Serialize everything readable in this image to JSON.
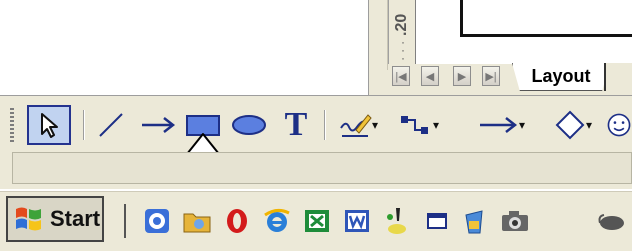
{
  "ruler": {
    "label": ".20",
    "dots": "· · ·"
  },
  "sheet_tabs": {
    "nav_first": "|◀",
    "nav_prev": "◀",
    "nav_next": "▶",
    "nav_last": "▶|",
    "active_tab": "Layout"
  },
  "drawing_toolbar": {
    "tools": [
      {
        "name": "select-tool",
        "icon": "pointer-arrow",
        "active": true
      },
      {
        "name": "line-tool",
        "icon": "line"
      },
      {
        "name": "arrow-tool",
        "icon": "arrow"
      },
      {
        "name": "rectangle-tool",
        "icon": "rectangle"
      },
      {
        "name": "ellipse-tool",
        "icon": "ellipse"
      },
      {
        "name": "text-tool",
        "icon": "T",
        "glyph": "T"
      },
      {
        "name": "freeform-line-tool",
        "icon": "freeform-line"
      },
      {
        "name": "connector-tool",
        "icon": "connector"
      },
      {
        "name": "arrows-tool",
        "icon": "arrows"
      },
      {
        "name": "flowchart-tool",
        "icon": "diamond"
      },
      {
        "name": "symbol-shapes-tool",
        "icon": "smiley"
      }
    ],
    "dropdown_glyph": "▾"
  },
  "annotation": {
    "icon": "up-arrow-pointer",
    "points_to": "rectangle-tool"
  },
  "taskbar": {
    "start_label": "Start",
    "quicklaunch": [
      "browser-icon",
      "folder-icon",
      "opera-icon",
      "internet-explorer-icon",
      "excel-icon",
      "word-icon",
      "paint-icon",
      "window-icon",
      "cup-icon",
      "camera-icon",
      "mouse-icon"
    ]
  },
  "colors": {
    "background": "#ece9d8",
    "shape_fill": "#5b7fe0",
    "selection_border": "#24338f",
    "selection_fill": "#c1d3f0"
  }
}
